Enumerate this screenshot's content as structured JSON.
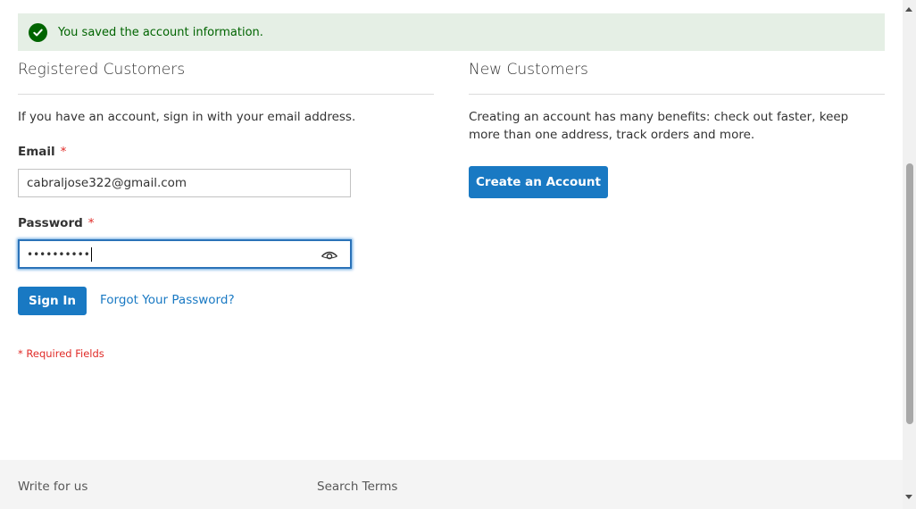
{
  "message": {
    "text": "You saved the account information.",
    "icon": "checkmark-icon",
    "color": "#006400"
  },
  "registered": {
    "title": "Registered Customers",
    "intro": "If you have an account, sign in with your email address.",
    "email_label": "Email",
    "email_value": "cabraljose322@gmail.com",
    "password_label": "Password",
    "password_value": "••••••••••",
    "required_star": "*",
    "sign_in_label": "Sign In",
    "forgot_label": "Forgot Your Password?",
    "required_note": "* Required Fields"
  },
  "new_customers": {
    "title": "New Customers",
    "intro": "Creating an account has many benefits: check out faster, keep more than one address, track orders and more.",
    "create_label": "Create an Account"
  },
  "footer": {
    "links": [
      "Write for us",
      "Search Terms"
    ]
  },
  "colors": {
    "primary": "#1979c3",
    "error": "#e02b27",
    "success_bg": "#e5efe5"
  }
}
